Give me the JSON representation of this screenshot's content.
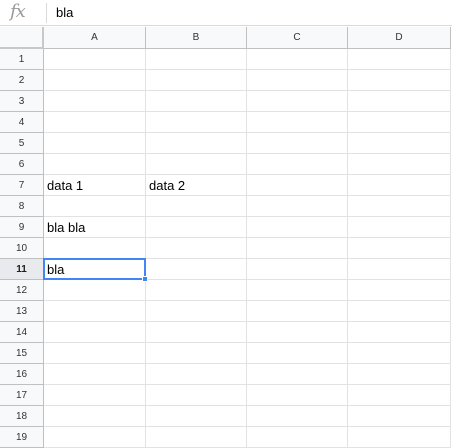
{
  "formula_bar": {
    "icon": "fx-icon",
    "icon_text": "fx",
    "value": "bla"
  },
  "columns": [
    "A",
    "B",
    "C",
    "D"
  ],
  "rows": [
    "1",
    "2",
    "3",
    "4",
    "5",
    "6",
    "7",
    "8",
    "9",
    "10",
    "11",
    "12",
    "13",
    "14",
    "15",
    "16",
    "17",
    "18",
    "19"
  ],
  "selected_cell": "A11",
  "cells": {
    "A7": "data 1",
    "B7": "data 2",
    "A9": "bla bla",
    "A11": "bla"
  },
  "colors": {
    "selection": "#4285f4",
    "header_bg": "#f8f9fa",
    "gridline": "#e2e2e2"
  }
}
